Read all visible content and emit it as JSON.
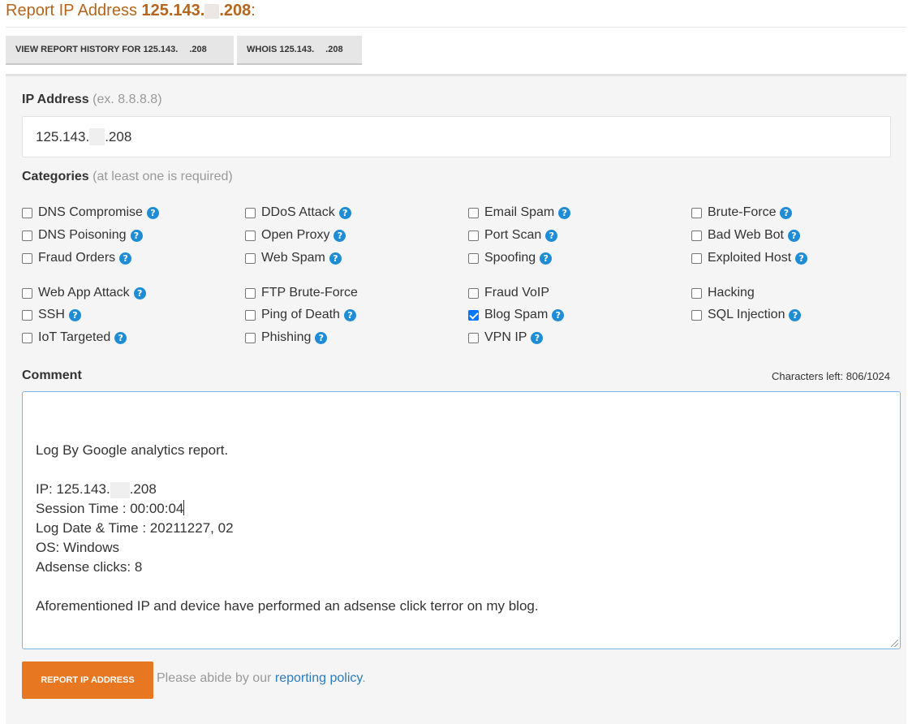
{
  "header": {
    "title_prefix": "Report IP Address ",
    "ip_start": "125.143.",
    "ip_end": ".208",
    "title_suffix": ":"
  },
  "buttons": {
    "history_prefix": "VIEW REPORT HISTORY FOR 125.143.",
    "history_suffix": ".208",
    "whois_prefix": "WHOIS 125.143.",
    "whois_suffix": ".208"
  },
  "form": {
    "ip_label": "IP Address",
    "ip_hint": "(ex. 8.8.8.8)",
    "ip_value_start": "125.143.",
    "ip_value_end": ".208",
    "categories_label": "Categories",
    "categories_hint": "(at least one is required)",
    "categories": [
      {
        "label": "DNS Compromise",
        "checked": false,
        "help": true
      },
      {
        "label": "DDoS Attack",
        "checked": false,
        "help": true
      },
      {
        "label": "Email Spam",
        "checked": false,
        "help": true
      },
      {
        "label": "Brute-Force",
        "checked": false,
        "help": true
      },
      {
        "label": "DNS Poisoning",
        "checked": false,
        "help": true
      },
      {
        "label": "Open Proxy",
        "checked": false,
        "help": true
      },
      {
        "label": "Port Scan",
        "checked": false,
        "help": true
      },
      {
        "label": "Bad Web Bot",
        "checked": false,
        "help": true
      },
      {
        "label": "Fraud Orders",
        "checked": false,
        "help": true
      },
      {
        "label": "Web Spam",
        "checked": false,
        "help": true
      },
      {
        "label": "Spoofing",
        "checked": false,
        "help": true
      },
      {
        "label": "Exploited Host",
        "checked": false,
        "help": true
      },
      {
        "label": "Web App Attack",
        "checked": false,
        "help": true
      },
      {
        "label": "FTP Brute-Force",
        "checked": false,
        "help": false
      },
      {
        "label": "Fraud VoIP",
        "checked": false,
        "help": false
      },
      {
        "label": "Hacking",
        "checked": false,
        "help": false
      },
      {
        "label": "SSH",
        "checked": false,
        "help": true
      },
      {
        "label": "Ping of Death",
        "checked": false,
        "help": true
      },
      {
        "label": "Blog Spam",
        "checked": true,
        "help": true
      },
      {
        "label": "SQL Injection",
        "checked": false,
        "help": true
      },
      {
        "label": "IoT Targeted",
        "checked": false,
        "help": true
      },
      {
        "label": "Phishing",
        "checked": false,
        "help": true
      },
      {
        "label": "VPN IP",
        "checked": false,
        "help": true
      }
    ],
    "help_glyph": "?",
    "comment_label": "Comment",
    "chars_left": "Characters left: 806/1024",
    "comment_lines": [
      "Log By Google analytics report.",
      "",
      "IP: 125.143.|.208",
      "Session Time : 00:00:04",
      "Log Date & Time : 20211227, 02",
      "OS: Windows",
      "Adsense clicks: 8",
      "",
      "Aforementioned IP and device have performed an adsense click terror on my blog."
    ],
    "submit_label": "REPORT IP ADDRESS",
    "policy_text": "Please abide by our ",
    "policy_link": "reporting policy",
    "policy_end": "."
  },
  "colors": {
    "accent": "#e87722",
    "title": "#b5651d",
    "link": "#2b7bb9",
    "help_icon": "#1f8dd6",
    "checkbox_checked": "#0075ff"
  }
}
